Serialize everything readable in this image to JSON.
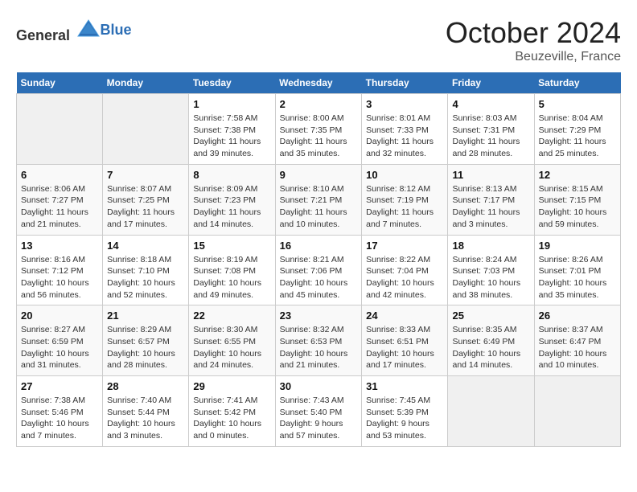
{
  "header": {
    "logo_general": "General",
    "logo_blue": "Blue",
    "month_title": "October 2024",
    "location": "Beuzeville, France"
  },
  "days_of_week": [
    "Sunday",
    "Monday",
    "Tuesday",
    "Wednesday",
    "Thursday",
    "Friday",
    "Saturday"
  ],
  "weeks": [
    [
      {
        "day": "",
        "sunrise": "",
        "sunset": "",
        "daylight": "",
        "empty": true
      },
      {
        "day": "",
        "sunrise": "",
        "sunset": "",
        "daylight": "",
        "empty": true
      },
      {
        "day": "1",
        "sunrise": "Sunrise: 7:58 AM",
        "sunset": "Sunset: 7:38 PM",
        "daylight": "Daylight: 11 hours and 39 minutes.",
        "empty": false
      },
      {
        "day": "2",
        "sunrise": "Sunrise: 8:00 AM",
        "sunset": "Sunset: 7:35 PM",
        "daylight": "Daylight: 11 hours and 35 minutes.",
        "empty": false
      },
      {
        "day": "3",
        "sunrise": "Sunrise: 8:01 AM",
        "sunset": "Sunset: 7:33 PM",
        "daylight": "Daylight: 11 hours and 32 minutes.",
        "empty": false
      },
      {
        "day": "4",
        "sunrise": "Sunrise: 8:03 AM",
        "sunset": "Sunset: 7:31 PM",
        "daylight": "Daylight: 11 hours and 28 minutes.",
        "empty": false
      },
      {
        "day": "5",
        "sunrise": "Sunrise: 8:04 AM",
        "sunset": "Sunset: 7:29 PM",
        "daylight": "Daylight: 11 hours and 25 minutes.",
        "empty": false
      }
    ],
    [
      {
        "day": "6",
        "sunrise": "Sunrise: 8:06 AM",
        "sunset": "Sunset: 7:27 PM",
        "daylight": "Daylight: 11 hours and 21 minutes.",
        "empty": false
      },
      {
        "day": "7",
        "sunrise": "Sunrise: 8:07 AM",
        "sunset": "Sunset: 7:25 PM",
        "daylight": "Daylight: 11 hours and 17 minutes.",
        "empty": false
      },
      {
        "day": "8",
        "sunrise": "Sunrise: 8:09 AM",
        "sunset": "Sunset: 7:23 PM",
        "daylight": "Daylight: 11 hours and 14 minutes.",
        "empty": false
      },
      {
        "day": "9",
        "sunrise": "Sunrise: 8:10 AM",
        "sunset": "Sunset: 7:21 PM",
        "daylight": "Daylight: 11 hours and 10 minutes.",
        "empty": false
      },
      {
        "day": "10",
        "sunrise": "Sunrise: 8:12 AM",
        "sunset": "Sunset: 7:19 PM",
        "daylight": "Daylight: 11 hours and 7 minutes.",
        "empty": false
      },
      {
        "day": "11",
        "sunrise": "Sunrise: 8:13 AM",
        "sunset": "Sunset: 7:17 PM",
        "daylight": "Daylight: 11 hours and 3 minutes.",
        "empty": false
      },
      {
        "day": "12",
        "sunrise": "Sunrise: 8:15 AM",
        "sunset": "Sunset: 7:15 PM",
        "daylight": "Daylight: 10 hours and 59 minutes.",
        "empty": false
      }
    ],
    [
      {
        "day": "13",
        "sunrise": "Sunrise: 8:16 AM",
        "sunset": "Sunset: 7:12 PM",
        "daylight": "Daylight: 10 hours and 56 minutes.",
        "empty": false
      },
      {
        "day": "14",
        "sunrise": "Sunrise: 8:18 AM",
        "sunset": "Sunset: 7:10 PM",
        "daylight": "Daylight: 10 hours and 52 minutes.",
        "empty": false
      },
      {
        "day": "15",
        "sunrise": "Sunrise: 8:19 AM",
        "sunset": "Sunset: 7:08 PM",
        "daylight": "Daylight: 10 hours and 49 minutes.",
        "empty": false
      },
      {
        "day": "16",
        "sunrise": "Sunrise: 8:21 AM",
        "sunset": "Sunset: 7:06 PM",
        "daylight": "Daylight: 10 hours and 45 minutes.",
        "empty": false
      },
      {
        "day": "17",
        "sunrise": "Sunrise: 8:22 AM",
        "sunset": "Sunset: 7:04 PM",
        "daylight": "Daylight: 10 hours and 42 minutes.",
        "empty": false
      },
      {
        "day": "18",
        "sunrise": "Sunrise: 8:24 AM",
        "sunset": "Sunset: 7:03 PM",
        "daylight": "Daylight: 10 hours and 38 minutes.",
        "empty": false
      },
      {
        "day": "19",
        "sunrise": "Sunrise: 8:26 AM",
        "sunset": "Sunset: 7:01 PM",
        "daylight": "Daylight: 10 hours and 35 minutes.",
        "empty": false
      }
    ],
    [
      {
        "day": "20",
        "sunrise": "Sunrise: 8:27 AM",
        "sunset": "Sunset: 6:59 PM",
        "daylight": "Daylight: 10 hours and 31 minutes.",
        "empty": false
      },
      {
        "day": "21",
        "sunrise": "Sunrise: 8:29 AM",
        "sunset": "Sunset: 6:57 PM",
        "daylight": "Daylight: 10 hours and 28 minutes.",
        "empty": false
      },
      {
        "day": "22",
        "sunrise": "Sunrise: 8:30 AM",
        "sunset": "Sunset: 6:55 PM",
        "daylight": "Daylight: 10 hours and 24 minutes.",
        "empty": false
      },
      {
        "day": "23",
        "sunrise": "Sunrise: 8:32 AM",
        "sunset": "Sunset: 6:53 PM",
        "daylight": "Daylight: 10 hours and 21 minutes.",
        "empty": false
      },
      {
        "day": "24",
        "sunrise": "Sunrise: 8:33 AM",
        "sunset": "Sunset: 6:51 PM",
        "daylight": "Daylight: 10 hours and 17 minutes.",
        "empty": false
      },
      {
        "day": "25",
        "sunrise": "Sunrise: 8:35 AM",
        "sunset": "Sunset: 6:49 PM",
        "daylight": "Daylight: 10 hours and 14 minutes.",
        "empty": false
      },
      {
        "day": "26",
        "sunrise": "Sunrise: 8:37 AM",
        "sunset": "Sunset: 6:47 PM",
        "daylight": "Daylight: 10 hours and 10 minutes.",
        "empty": false
      }
    ],
    [
      {
        "day": "27",
        "sunrise": "Sunrise: 7:38 AM",
        "sunset": "Sunset: 5:46 PM",
        "daylight": "Daylight: 10 hours and 7 minutes.",
        "empty": false
      },
      {
        "day": "28",
        "sunrise": "Sunrise: 7:40 AM",
        "sunset": "Sunset: 5:44 PM",
        "daylight": "Daylight: 10 hours and 3 minutes.",
        "empty": false
      },
      {
        "day": "29",
        "sunrise": "Sunrise: 7:41 AM",
        "sunset": "Sunset: 5:42 PM",
        "daylight": "Daylight: 10 hours and 0 minutes.",
        "empty": false
      },
      {
        "day": "30",
        "sunrise": "Sunrise: 7:43 AM",
        "sunset": "Sunset: 5:40 PM",
        "daylight": "Daylight: 9 hours and 57 minutes.",
        "empty": false
      },
      {
        "day": "31",
        "sunrise": "Sunrise: 7:45 AM",
        "sunset": "Sunset: 5:39 PM",
        "daylight": "Daylight: 9 hours and 53 minutes.",
        "empty": false
      },
      {
        "day": "",
        "sunrise": "",
        "sunset": "",
        "daylight": "",
        "empty": true
      },
      {
        "day": "",
        "sunrise": "",
        "sunset": "",
        "daylight": "",
        "empty": true
      }
    ]
  ]
}
